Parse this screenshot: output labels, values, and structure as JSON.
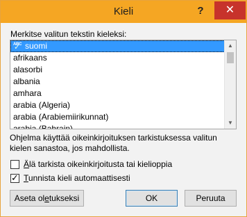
{
  "window": {
    "title": "Kieli",
    "help_label": "?",
    "close_label": "✕",
    "accent_color": "#f5a623",
    "close_color": "#c7332b"
  },
  "language_list": {
    "label": "Merkitse valitun tekstin kieleksi:",
    "selected_icon": "spellcheck-abc-icon",
    "items": [
      "suomi",
      "afrikaans",
      "alasorbi",
      "albania",
      "amhara",
      "arabia (Algeria)",
      "arabia (Arabiemiirikunnat)",
      "arabia (Bahrain)"
    ],
    "selected_index": 0
  },
  "info": {
    "text": "Ohjelma käyttää oikeinkirjoituksen tarkistuksessa valitun kielen sanastoa, jos mahdollista."
  },
  "options": {
    "no_proofing": {
      "prefix": "",
      "accel": "Ä",
      "rest": "lä tarkista oikeinkirjoitusta tai kielioppia",
      "checked": false
    },
    "detect_language": {
      "prefix": "",
      "accel": "T",
      "rest": "unnista kieli automaattisesti",
      "checked": true
    }
  },
  "buttons": {
    "set_default": {
      "prefix": "Aseta ol",
      "accel": "e",
      "rest": "tukseksi"
    },
    "ok": "OK",
    "cancel": "Peruuta"
  }
}
